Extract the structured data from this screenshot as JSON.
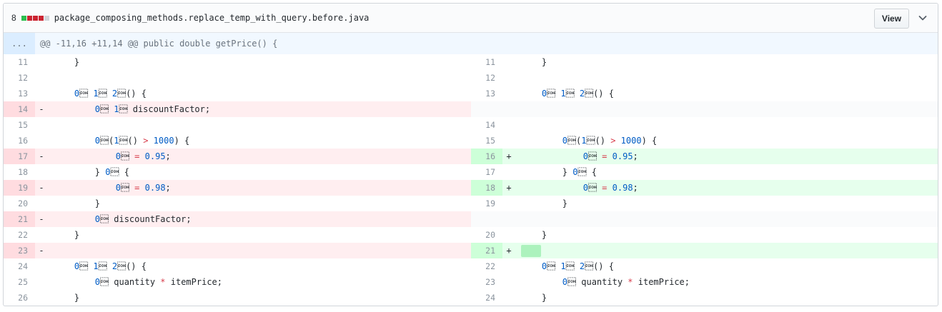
{
  "header": {
    "changes_count": "8",
    "diffstat_colors": [
      "#2cbe4e",
      "#cb2431",
      "#cb2431",
      "#cb2431",
      "#d1d5da"
    ],
    "file_name": "package_composing_methods.replace_temp_with_query.before.java",
    "view_label": "View",
    "toggle_icon": "chevron-down-icon"
  },
  "hunk": {
    "expand_label": "...",
    "header": "@@ -11,16 +11,14 @@ public double getPrice() {"
  },
  "left": {
    "lines": [
      {
        "num": "11",
        "marker": "",
        "code": "    }"
      },
      {
        "num": "12",
        "marker": "",
        "code": ""
      },
      {
        "num": "13",
        "marker": "",
        "code": "    private double discountFactor() {"
      },
      {
        "num": "14",
        "marker": "-",
        "code": "        final double discountFactor;"
      },
      {
        "num": "15",
        "marker": "",
        "code": ""
      },
      {
        "num": "16",
        "marker": "",
        "code": "        if(basePrice() > 1000) {"
      },
      {
        "num": "17",
        "marker": "-",
        "code": "            discountFactor = 0.95;"
      },
      {
        "num": "18",
        "marker": "",
        "code": "        } else {"
      },
      {
        "num": "19",
        "marker": "-",
        "code": "            discountFactor = 0.98;"
      },
      {
        "num": "20",
        "marker": "",
        "code": "        }"
      },
      {
        "num": "21",
        "marker": "-",
        "code": "        return discountFactor;"
      },
      {
        "num": "22",
        "marker": "",
        "code": "    }"
      },
      {
        "num": "23",
        "marker": "-",
        "code": ""
      },
      {
        "num": "24",
        "marker": "",
        "code": "    private int basePrice() {"
      },
      {
        "num": "25",
        "marker": "",
        "code": "        return quantity * itemPrice;"
      },
      {
        "num": "26",
        "marker": "",
        "code": "    }"
      }
    ]
  },
  "right": {
    "lines": [
      {
        "num": "11",
        "marker": "",
        "code": "    }"
      },
      {
        "num": "12",
        "marker": "",
        "code": ""
      },
      {
        "num": "13",
        "marker": "",
        "code": "    private double discountFactor() {"
      },
      {
        "num": "",
        "marker": "",
        "code": ""
      },
      {
        "num": "14",
        "marker": "",
        "code": ""
      },
      {
        "num": "15",
        "marker": "",
        "code": "        if(basePrice() > 1000) {"
      },
      {
        "num": "16",
        "marker": "+",
        "code": "            return = 0.95;"
      },
      {
        "num": "17",
        "marker": "",
        "code": "        } else {"
      },
      {
        "num": "18",
        "marker": "+",
        "code": "            return = 0.98;"
      },
      {
        "num": "19",
        "marker": "",
        "code": "        }"
      },
      {
        "num": "",
        "marker": "",
        "code": ""
      },
      {
        "num": "20",
        "marker": "",
        "code": "    }"
      },
      {
        "num": "21",
        "marker": "+",
        "code": ""
      },
      {
        "num": "22",
        "marker": "",
        "code": "    private int basePrice() {"
      },
      {
        "num": "23",
        "marker": "",
        "code": "        return quantity * itemPrice;"
      },
      {
        "num": "24",
        "marker": "",
        "code": "    }"
      }
    ]
  }
}
